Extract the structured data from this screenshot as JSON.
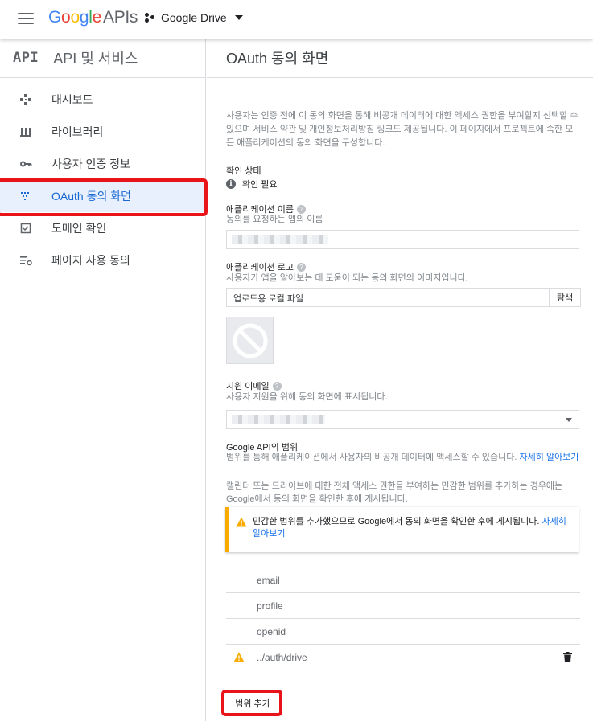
{
  "topbar": {
    "logo_google": [
      "G",
      "o",
      "o",
      "g",
      "l",
      "e"
    ],
    "logo_apis": "APIs",
    "project_name": "Google Drive"
  },
  "sidebar": {
    "logo_text": "API",
    "title": "API 및 서비스",
    "items": [
      {
        "label": "대시보드",
        "icon": "dashboard-icon"
      },
      {
        "label": "라이브러리",
        "icon": "library-icon"
      },
      {
        "label": "사용자 인증 정보",
        "icon": "key-icon"
      },
      {
        "label": "OAuth 동의 화면",
        "icon": "consent-screen-icon",
        "active": true
      },
      {
        "label": "도메인 확인",
        "icon": "checkbox-icon"
      },
      {
        "label": "페이지 사용 동의",
        "icon": "settings-list-icon"
      }
    ]
  },
  "main": {
    "title": "OAuth 동의 화면",
    "description": "사용자는 인증 전에 이 동의 화면을 통해 비공개 데이터에 대한 액세스 권한을 부여할지 선택할 수 있으며 서비스 약관 및 개인정보처리방침 링크도 제공됩니다. 이 페이지에서 프로젝트에 속한 모든 애플리케이션의 동의 화면을 구성합니다.",
    "verification": {
      "title": "확인 상태",
      "status": "확인 필요"
    },
    "app_name": {
      "title": "애플리케이션 이름",
      "subtitle": "동의를 요청하는 앱의 이름"
    },
    "app_logo": {
      "title": "애플리케이션 로고",
      "subtitle": "사용자가 앱을 알아보는 데 도움이 되는 동의 화면의 이미지입니다.",
      "placeholder": "업로드용 로컬 파일",
      "browse_label": "탐색"
    },
    "support_email": {
      "title": "지원 이메일",
      "subtitle": "사용자 지원을 위해 동의 화면에 표시됩니다."
    },
    "scopes": {
      "title": "Google API의 범위",
      "desc1": "범위를 통해 애플리케이션에서 사용자의 비공개 데이터에 액세스할 수 있습니다.",
      "learn_more": "자세히 알아보기",
      "desc2": "캘린더 또는 드라이브에 대한 전체 액세스 권한을 부여하는 민감한 범위를 추가하는 경우에는 Google에서 동의 화면을 확인한 후에 게시됩니다.",
      "warning": "민감한 범위를 추가했으므로 Google에서 동의 화면을 확인한 후에 게시됩니다.",
      "warning_link": "자세히 알아보기",
      "items": [
        "email",
        "profile",
        "openid",
        "../auth/drive"
      ],
      "add_button": "범위 추가"
    }
  },
  "colors": {
    "accent": "#1a73e8",
    "active_bg": "#e8f0fe",
    "warning": "#f9ab00",
    "highlight": "#e8141a"
  }
}
